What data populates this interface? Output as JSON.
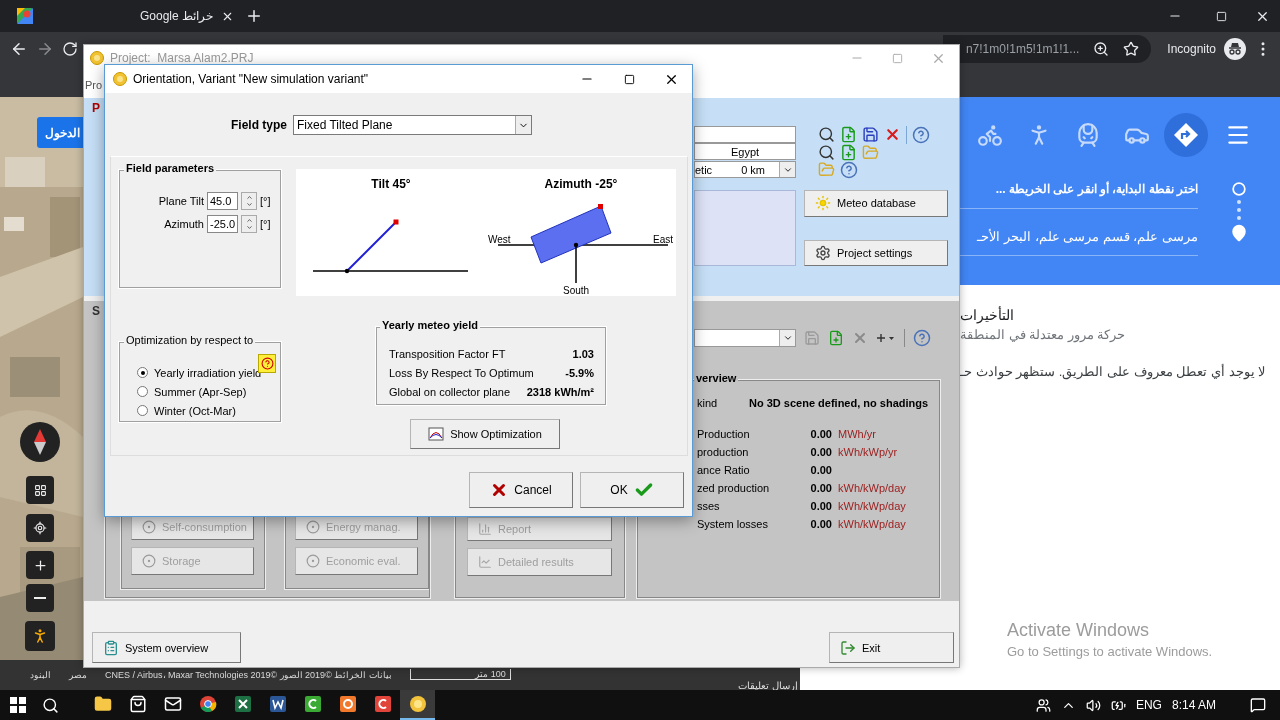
{
  "browser": {
    "tab": {
      "title": "خرائط Google"
    },
    "address_tail": "n7!1m0!1m5!1m1!1...",
    "profile": "Incognito"
  },
  "map": {
    "sign_in": "الدخول",
    "scale": "100 متر",
    "attribution": [
      "بيانات الخرائط ©2019 الصور ©2019 CNES / Airbus، Maxar Technologies",
      "مصر",
      "البنود"
    ],
    "feedback": "إرسال تعليقات"
  },
  "directions": {
    "modes": [
      {
        "kind": "bike",
        "selected": false
      },
      {
        "kind": "walk",
        "selected": false
      },
      {
        "kind": "transit",
        "selected": false
      },
      {
        "kind": "car",
        "selected": false
      },
      {
        "kind": "route",
        "selected": true
      }
    ],
    "start": {
      "placeholder": "اختر نقطة البداية، أو انقر على الخريطة ..."
    },
    "destination": {
      "value": "مرسى علم، قسم مرسى علم، البحر الأحـ"
    }
  },
  "traffic": {
    "title": "التأخيرات",
    "summary": "حركة مرور معتدلة في المنطقة",
    "incidents": "لا يوجد أي تعطل معروف على الطريق. ستظهر حوادث حـ"
  },
  "project": {
    "title": "Project:  Marsa Alam2.PRJ",
    "menu_fragment": "Pro",
    "section_fragments": [
      "P",
      "S"
    ],
    "country": "Egypt",
    "site_fragment": "etic",
    "distance": "0 km",
    "meteo_button": "Meteo database",
    "settings_button": "Project settings",
    "overview": {
      "title_fragment": "verview",
      "kind_label": "kind",
      "kind_value": "No 3D scene defined, no shadings",
      "rows": [
        {
          "label": "Production",
          "value": "0.00",
          "unit": "MWh/yr"
        },
        {
          "label": "production",
          "value": "0.00",
          "unit": "kWh/kWp/yr"
        },
        {
          "label": "ance Ratio",
          "value": "0.00"
        },
        {
          "label": "zed production",
          "value": "0.00",
          "unit": "kWh/kWp/day"
        },
        {
          "label": "sses",
          "value": "0.00",
          "unit": "kWh/kWp/day"
        },
        {
          "label": "System losses",
          "value": "0.00",
          "unit": "kWh/kWp/day"
        }
      ]
    },
    "groups": [
      [
        {
          "label": "Self-consumption",
          "kind": "option",
          "disabled": true
        },
        {
          "label": "Storage",
          "kind": "option",
          "disabled": true
        }
      ],
      [
        {
          "label": "Energy manag.",
          "kind": "option",
          "disabled": true
        },
        {
          "label": "Economic eval.",
          "kind": "option",
          "disabled": true
        }
      ],
      [
        {
          "label": "Report",
          "kind": "report",
          "disabled": true
        },
        {
          "label": "Detailed results",
          "kind": "chart",
          "disabled": true
        }
      ]
    ],
    "system_overview": "System overview",
    "exit": "Exit"
  },
  "dialog": {
    "title": "Orientation, Variant \"New simulation variant\"",
    "field_type_label": "Field type",
    "field_type": "Fixed Tilted Plane",
    "parameters": {
      "title": "Field parameters",
      "fields": [
        {
          "label": "Plane Tilt",
          "value": "45.0",
          "unit": "[°]"
        },
        {
          "label": "Azimuth",
          "value": "-25.0",
          "unit": "[°]"
        }
      ]
    },
    "tilt_title": "Tilt 45°",
    "azimuth_title": "Azimuth -25°",
    "compass": {
      "west": "West",
      "east": "East",
      "south": "South"
    },
    "optimization": {
      "title": "Optimization by respect to",
      "options": [
        {
          "label": "Yearly irradiation yield",
          "selected": true
        },
        {
          "label": "Summer (Apr-Sep)",
          "selected": false
        },
        {
          "label": "Winter (Oct-Mar)",
          "selected": false
        }
      ]
    },
    "yield": {
      "title": "Yearly meteo yield",
      "rows": [
        {
          "label": "Transposition Factor FT",
          "value": "1.03"
        },
        {
          "label": "Loss By Respect To Optimum",
          "value": "-5.9%"
        },
        {
          "label": "Global on collector plane",
          "value": "2318 kWh/m²"
        }
      ]
    },
    "show_optimization": "Show Optimization",
    "cancel": "Cancel",
    "ok": "OK"
  },
  "activation": {
    "title": "Activate Windows",
    "hint": "Go to Settings to activate Windows."
  },
  "taskbar": {
    "apps": [
      {
        "kind": "explorer",
        "selected": false
      },
      {
        "kind": "store",
        "selected": false
      },
      {
        "kind": "mail",
        "selected": false
      },
      {
        "kind": "browser",
        "selected": false
      },
      {
        "kind": "sheet",
        "selected": false
      },
      {
        "kind": "doc",
        "selected": false
      },
      {
        "kind": "recorder",
        "selected": false
      },
      {
        "kind": "orange",
        "selected": false
      },
      {
        "kind": "red",
        "selected": false
      },
      {
        "kind": "sun",
        "selected": true
      }
    ],
    "language": "ENG",
    "time": "8:14 AM"
  }
}
